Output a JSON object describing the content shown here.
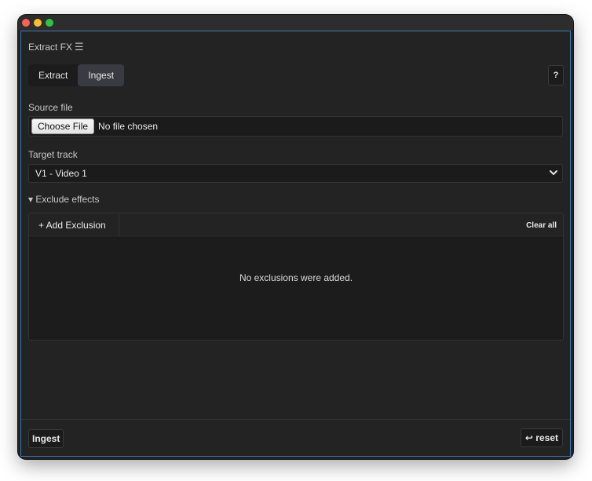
{
  "app": {
    "title": "Extract FX",
    "menu_icon": "hamburger-menu-icon"
  },
  "tabs": [
    {
      "label": "Extract",
      "active": false
    },
    {
      "label": "Ingest",
      "active": true
    }
  ],
  "help": {
    "label": "?"
  },
  "source_file": {
    "label": "Source file",
    "button_label": "Choose File",
    "status": "No file chosen"
  },
  "target_track": {
    "label": "Target track",
    "selected": "V1 - Video 1"
  },
  "exclude_effects": {
    "toggle_label": "▾ Exclude effects",
    "expanded": true,
    "add_label": "+ Add Exclusion",
    "clear_label": "Clear all",
    "empty_message": "No exclusions were added."
  },
  "footer": {
    "ingest_label": "Ingest",
    "reset_label": "↩ reset"
  },
  "colors": {
    "background": "#232323",
    "accent_border": "#3b78b5",
    "active_tab": "#3a3a42"
  }
}
